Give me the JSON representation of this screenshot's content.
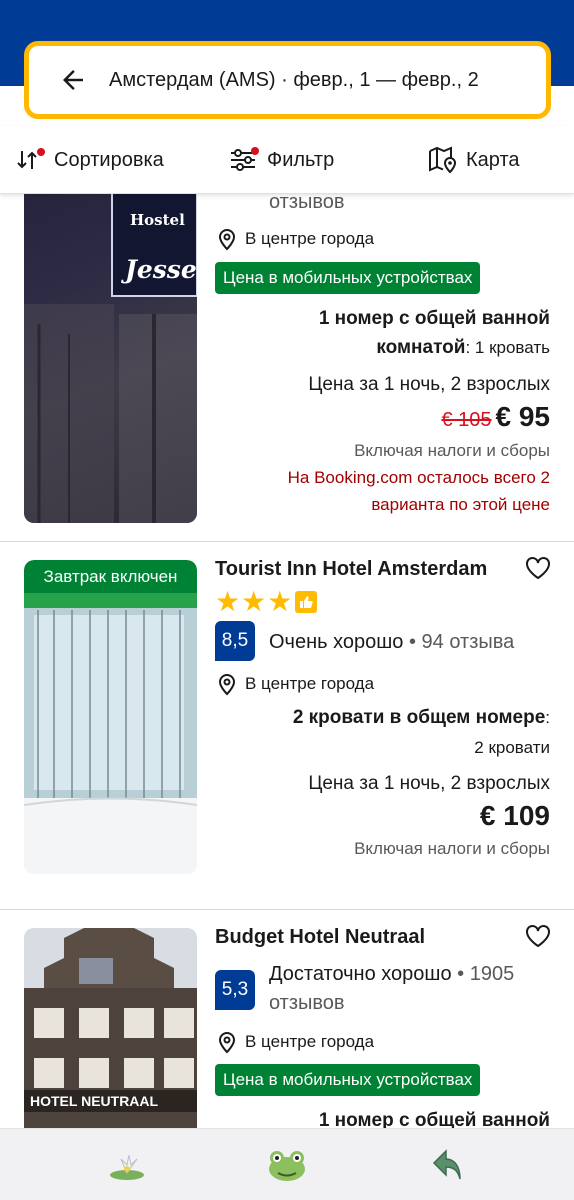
{
  "search": {
    "text": "Амстердам (AMS) · февр., 1 — февр., 2"
  },
  "toolbar": {
    "sort_label": "Сортировка",
    "filter_label": "Фильтр",
    "map_label": "Карта"
  },
  "colors": {
    "brand": "#003b95",
    "accent": "#ffb700",
    "green": "#008234",
    "red": "#d4111e",
    "dot": "#d4111e"
  },
  "hotels": [
    {
      "reviews_tail": "отзывов",
      "location": "В центре города",
      "mobile_badge": "Цена в мобильных устройствах",
      "room_bold": "1 номер с общей ванной",
      "room_bold2": "комнатой",
      "room_tail": ": 1 кровать",
      "price_label": "Цена за 1 ночь, 2 взрослых",
      "price_old": "€ 105",
      "price": "€ 95",
      "tax_note": "Включая налоги и сборы",
      "warning_1": "На Booking.com осталось всего 2",
      "warning_2": "варианта по этой цене",
      "photo_sign_1": "Hostel",
      "photo_sign_2": "Jesse"
    },
    {
      "breakfast_badge": "Завтрак включен",
      "name": "Tourist Inn Hotel Amsterdam",
      "stars": 3,
      "score": "8,5",
      "score_word": "Очень хорошо",
      "review_count": " • 94 отзыва",
      "location": "В центре города",
      "room_bold": "2 кровати в общем номере",
      "room_colon": ":",
      "room_tail": "2 кровати",
      "price_label": "Цена за 1 ночь, 2 взрослых",
      "price": "€ 109",
      "tax_note": "Включая налоги и сборы"
    },
    {
      "name": "Budget Hotel Neutraal",
      "score": "5,3",
      "score_word": "Достаточно хорошо",
      "review_count": " • 1905",
      "reviews_tail": "отзывов",
      "location": "В центре города",
      "mobile_badge": "Цена в мобильных устройствах",
      "room_bold": "1 номер с общей ванной",
      "photo_sign": "HOTEL NEUTRAAL"
    }
  ],
  "bottom_nav": {
    "icons": [
      "water-lily-icon",
      "frog-icon",
      "back-arrow-icon"
    ]
  }
}
